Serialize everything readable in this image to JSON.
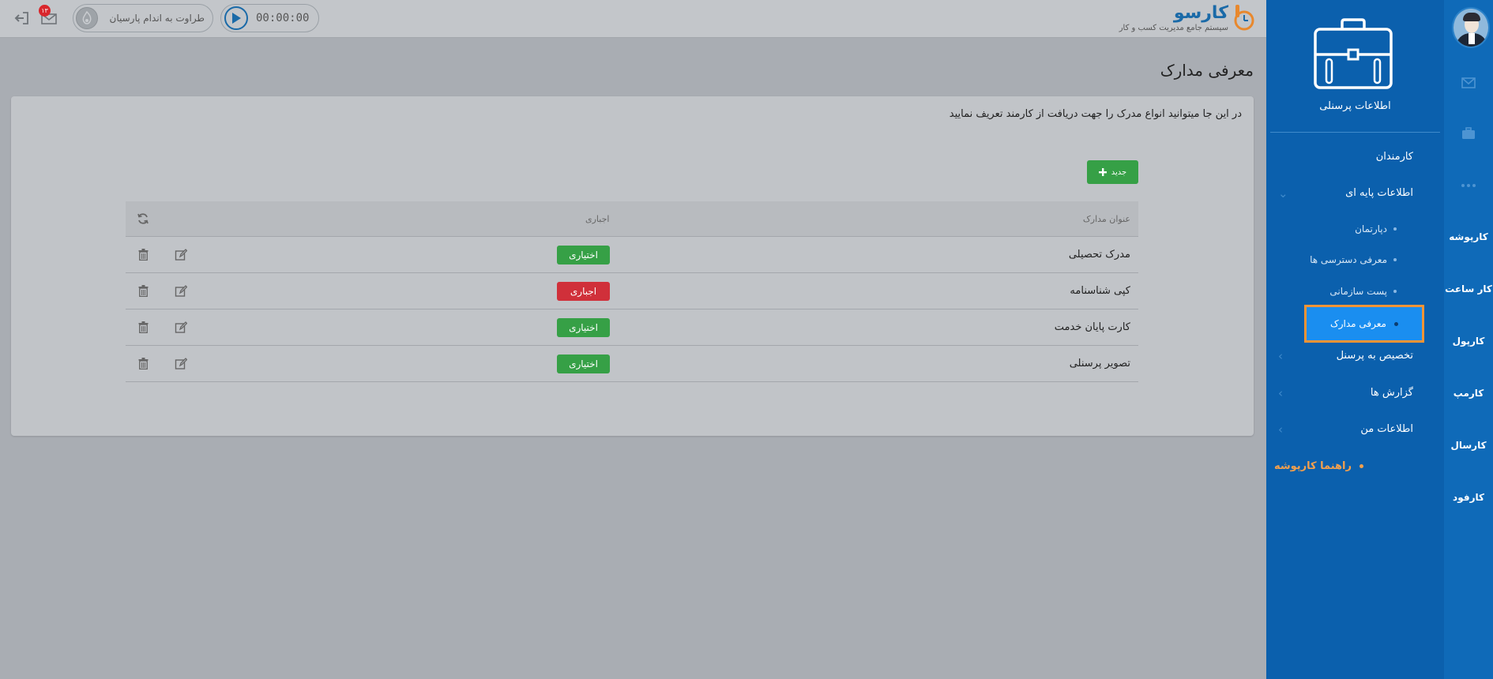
{
  "header": {
    "logo_main": "کارسو",
    "logo_sub": "سیستم جامع مدیریت کسب و کار",
    "timer": "00:00:00",
    "company": "طراوت به اندام پارسیان",
    "mail_badge": "۱۳"
  },
  "rail": {
    "items": [
      "کارپوشه",
      "کار ساعت",
      "کارپول",
      "کارمپ",
      "کارسال",
      "کارفود"
    ]
  },
  "sidebar": {
    "title": "اطلاعات پرسنلی",
    "menu": {
      "employees": "کارمندان",
      "basic_info": "اطلاعات پایه ای",
      "sub": [
        "دپارتمان",
        "معرفی دسترسی ها",
        "پست سازمانی"
      ],
      "active_sub": "معرفی مدارک",
      "assign": "تخصیص به پرسنل",
      "reports": "گزارش ها",
      "my_info": "اطلاعات من",
      "guide": "راهنما کارپوشه"
    }
  },
  "main": {
    "title": "معرفی مدارک",
    "description": "در این جا میتوانید انواع مدرک را جهت دریافت از کارمند تعریف نمایید",
    "add_button": "جدید",
    "table": {
      "headers": {
        "title": "عنوان مدارک",
        "required": "اجباری"
      },
      "rows": [
        {
          "title": "مدرک تحصیلی",
          "status": "اختیاری"
        },
        {
          "title": "کپی شناسنامه",
          "status": "اجباری"
        },
        {
          "title": "کارت پایان خدمت",
          "status": "اختیاری"
        },
        {
          "title": "تصویر پرسنلی",
          "status": "اختیاری"
        }
      ]
    }
  },
  "colors": {
    "sidebar_bg": "#0b60ad",
    "active_highlight": "#1a8ef0",
    "active_border": "#f49435",
    "optional_badge": "#36a046",
    "required_badge": "#d0303a"
  }
}
